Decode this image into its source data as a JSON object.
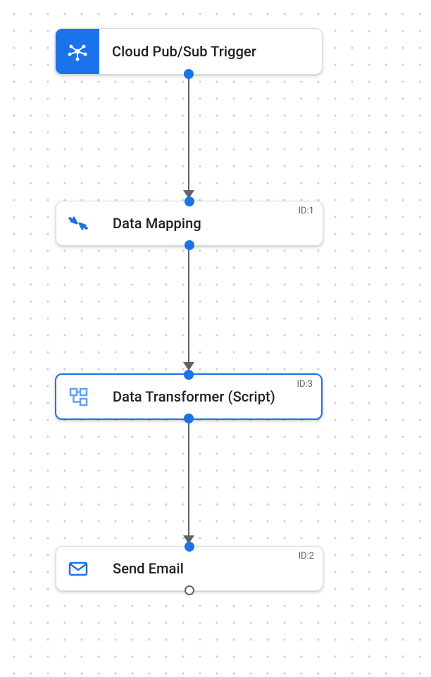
{
  "nodes": {
    "trigger": {
      "label": "Cloud Pub/Sub Trigger",
      "id": "",
      "icon": "pubsub-hub-icon"
    },
    "mapping": {
      "label": "Data Mapping",
      "id": "ID:1",
      "icon": "converge-arrows-icon"
    },
    "transformer": {
      "label": "Data Transformer (Script)",
      "id": "ID:3",
      "icon": "sitemap-icon"
    },
    "sendemail": {
      "label": "Send Email",
      "id": "ID:2",
      "icon": "envelope-icon"
    }
  }
}
